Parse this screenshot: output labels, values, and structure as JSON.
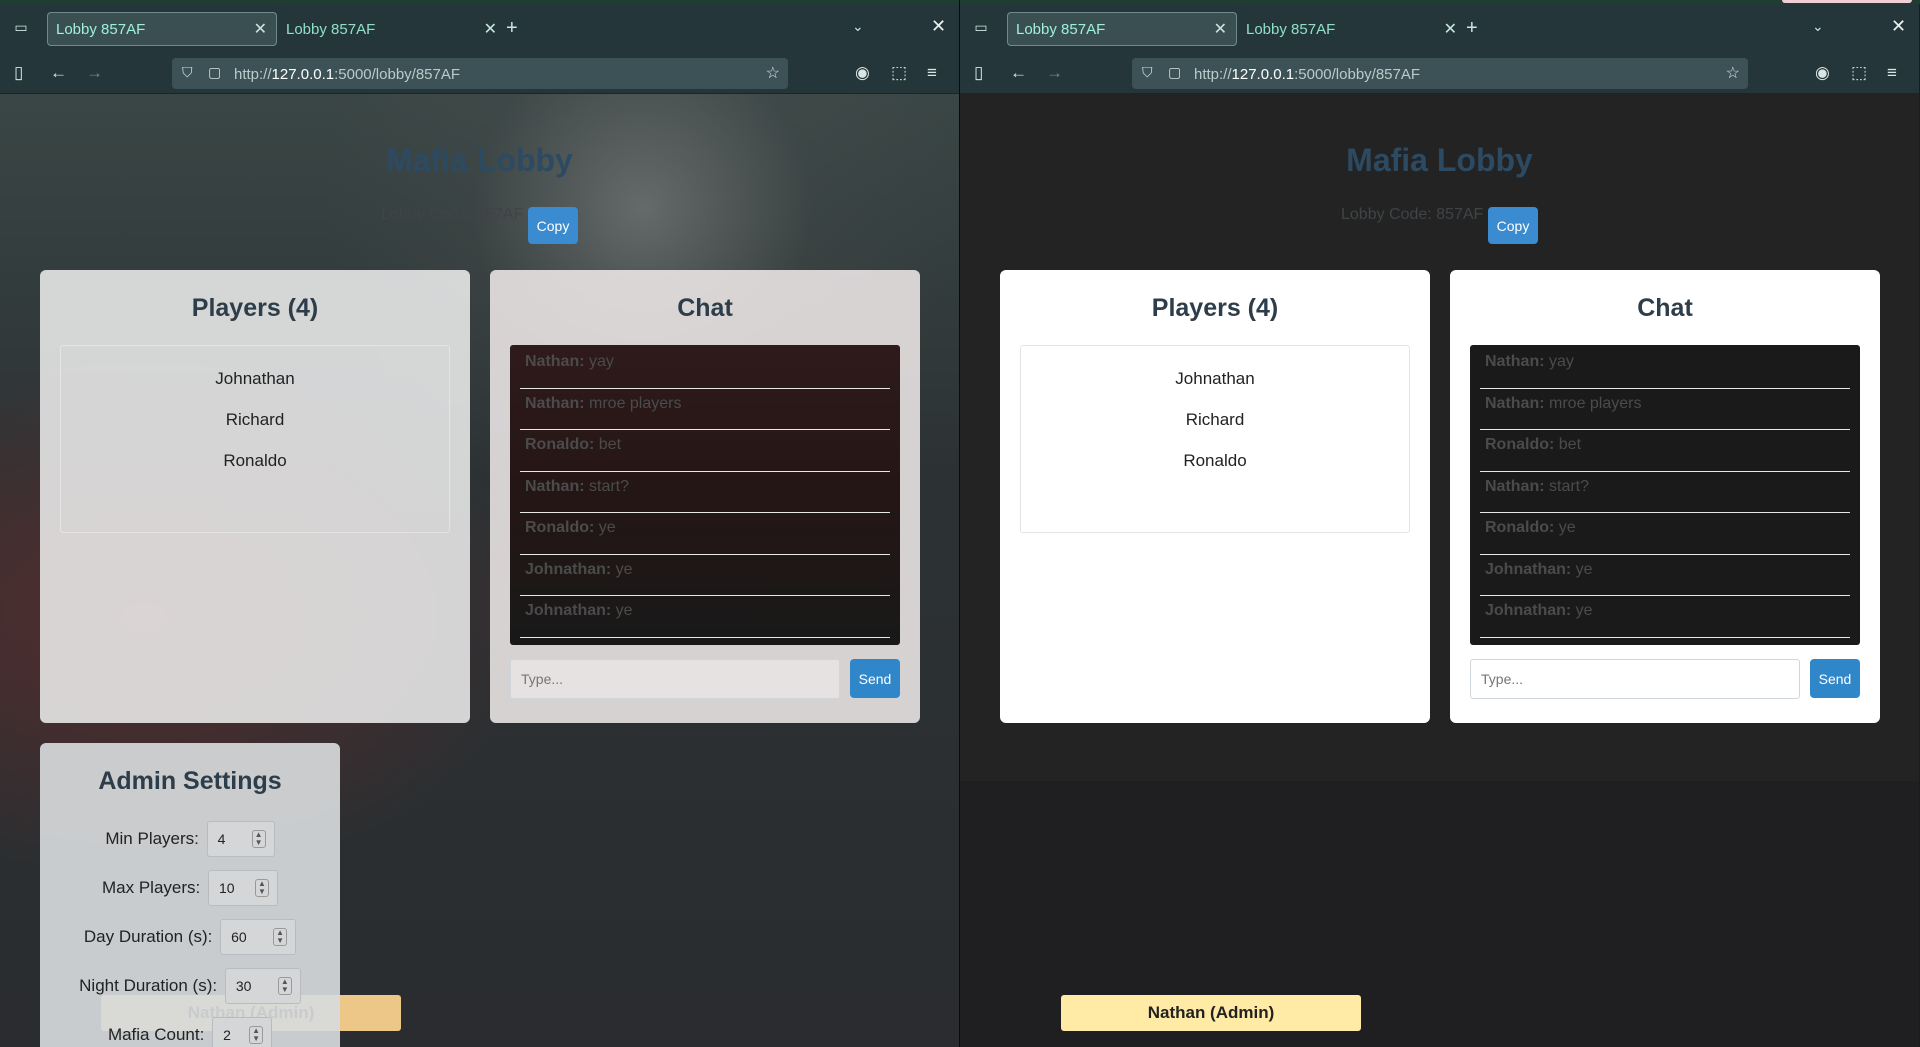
{
  "windows": {
    "left": {
      "tabs": [
        {
          "label": "Lobby 857AF",
          "active": true
        },
        {
          "label": "Lobby 857AF",
          "active": false
        }
      ],
      "url": {
        "prefix": "http://",
        "host": "127.0.0.1",
        "rest": ":5000/lobby/857AF"
      }
    },
    "right": {
      "tabs": [
        {
          "label": "Lobby 857AF",
          "active": true
        },
        {
          "label": "Lobby 857AF",
          "active": false
        }
      ],
      "url": {
        "prefix": "http://",
        "host": "127.0.0.1",
        "rest": ":5000/lobby/857AF"
      }
    }
  },
  "icons": {
    "tab_list": "tab-list-icon",
    "close_tab": "close-icon",
    "new_tab": "plus-icon",
    "list_all_tabs": "chevron-down-icon",
    "sidebar": "sidebar-icon",
    "back": "arrow-left-icon",
    "forward": "arrow-right-icon",
    "tracking_protection": "shield-icon",
    "page_info": "page-icon",
    "bookmark": "star-icon",
    "account": "account-icon",
    "extensions": "puzzle-icon",
    "menu": "hamburger-icon"
  },
  "lobby": {
    "title": "Mafia Lobby",
    "code_label": "Lobby Code: 857AF",
    "copy_label": "Copy",
    "players_title": "Players (4)",
    "players": [
      "Nathan (Admin)",
      "Johnathan",
      "Richard",
      "Ronaldo"
    ],
    "chat_title": "Chat",
    "messages": [
      {
        "who": "Nathan:",
        "text": " yay"
      },
      {
        "who": "Nathan:",
        "text": " mroe players"
      },
      {
        "who": "Ronaldo:",
        "text": " bet"
      },
      {
        "who": "Nathan:",
        "text": " start?"
      },
      {
        "who": "Ronaldo:",
        "text": " ye"
      },
      {
        "who": "Johnathan:",
        "text": " ye"
      },
      {
        "who": "Johnathan:",
        "text": " ye"
      }
    ],
    "chat_placeholder": "Type...",
    "send_label": "Send"
  },
  "admin_settings": {
    "title": "Admin Settings",
    "min_players_label": "Min Players:",
    "min_players": "4",
    "max_players_label": "Max Players:",
    "max_players": "10",
    "day_label": "Day Duration (s):",
    "day": "60",
    "night_label": "Night Duration (s):",
    "night": "30",
    "mafia_label": "Mafia Count:",
    "mafia": "2"
  },
  "colors": {
    "accent": "#3b8bd0",
    "admin_highlight": "#ffeaa6",
    "title": "#2d4a63"
  }
}
